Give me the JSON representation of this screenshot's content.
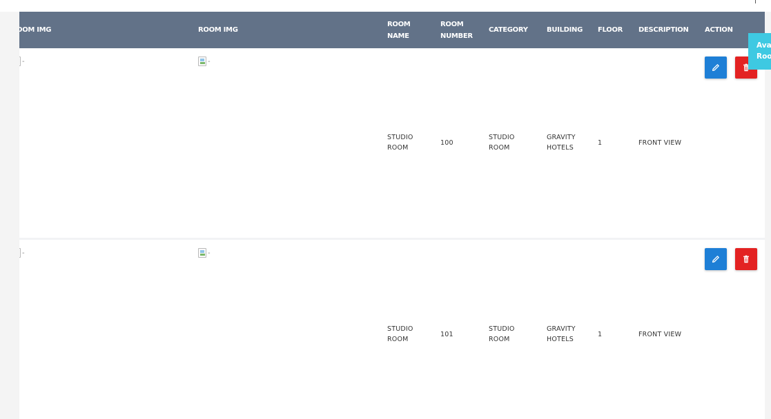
{
  "table": {
    "headers": {
      "room_img_1": "OOM IMG",
      "room_img_2": "ROOM IMG",
      "room_name": "ROOM NAME",
      "room_number": "ROOM NUMBER",
      "category": "CATEGORY",
      "building": "BUILDING",
      "floor": "FLOOR",
      "description": "DESCRIPTION",
      "action": "ACTION"
    },
    "rows": [
      {
        "img_alt_1": "-",
        "img_alt_2": "-",
        "room_name": "STUDIO ROOM",
        "room_number": "100",
        "category": "STUDIO ROOM",
        "building": "GRAVITY HOTELS",
        "floor": "1",
        "description": "FRONT VIEW"
      },
      {
        "img_alt_1": "-",
        "img_alt_2": "-",
        "room_name": "STUDIO ROOM",
        "room_number": "101",
        "category": "STUDIO ROOM",
        "building": "GRAVITY HOTELS",
        "floor": "1",
        "description": "FRONT VIEW"
      }
    ]
  },
  "side_badge": {
    "line1": "Ava",
    "line2": "Roo"
  },
  "icons": {
    "edit": "pencil-icon",
    "delete": "trash-icon",
    "image": "broken-image-icon"
  },
  "colors": {
    "header_bg": "#627288",
    "edit_button": "#1e7fd6",
    "delete_button": "#e32222",
    "badge": "#3ec9e2"
  }
}
